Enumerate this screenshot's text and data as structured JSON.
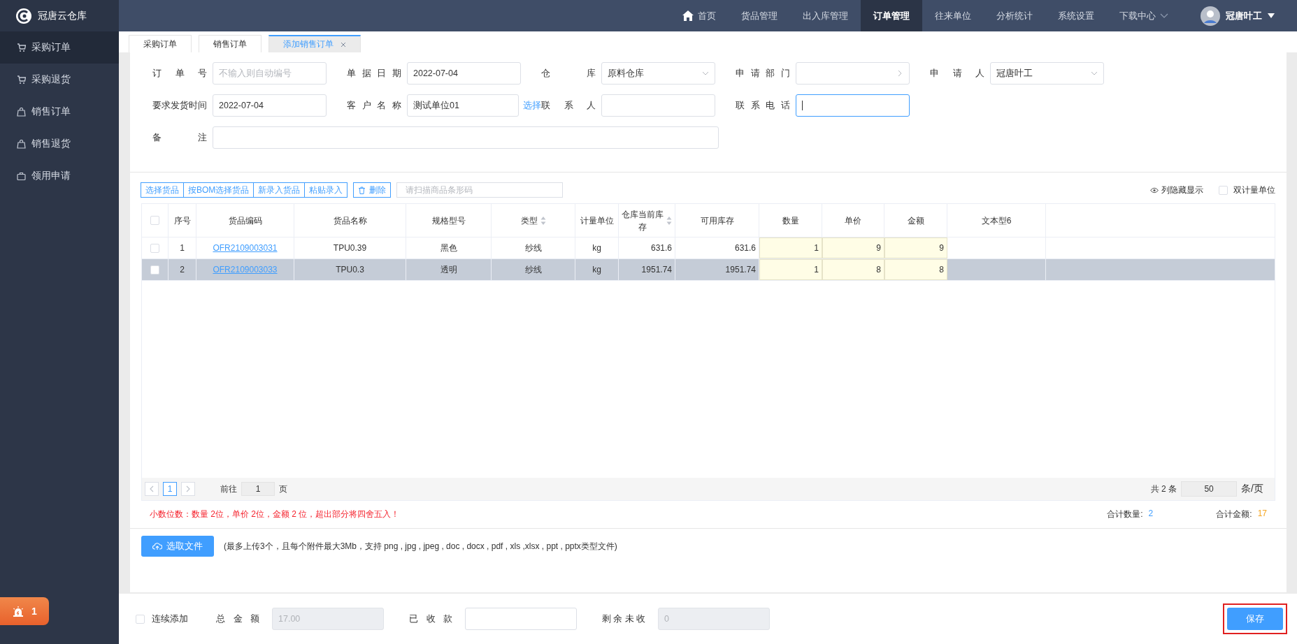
{
  "app": {
    "logo_text": "冠唐云仓库"
  },
  "nav": [
    {
      "label": "首页",
      "selected": false,
      "kind": "home"
    },
    {
      "label": "货品管理",
      "selected": false,
      "kind": "plain"
    },
    {
      "label": "出入库管理",
      "selected": false,
      "kind": "plain"
    },
    {
      "label": "订单管理",
      "selected": true,
      "kind": "plain"
    },
    {
      "label": "往来单位",
      "selected": false,
      "kind": "plain"
    },
    {
      "label": "分析统计",
      "selected": false,
      "kind": "plain"
    },
    {
      "label": "系统设置",
      "selected": false,
      "kind": "plain"
    },
    {
      "label": "下载中心",
      "selected": false,
      "kind": "dropdown"
    }
  ],
  "user": {
    "name": "冠唐叶工"
  },
  "sidebar": {
    "items": [
      {
        "label": "采购订单",
        "selected": true,
        "kind": "cart"
      },
      {
        "label": "采购退货",
        "selected": false,
        "kind": "cart"
      },
      {
        "label": "销售订单",
        "selected": false,
        "kind": "bag"
      },
      {
        "label": "销售退货",
        "selected": false,
        "kind": "bag"
      },
      {
        "label": "领用申请",
        "selected": false,
        "kind": "case"
      }
    ]
  },
  "alert_badge": {
    "count": "1"
  },
  "tabs": [
    {
      "label": "采购订单",
      "selected": false,
      "closable": false
    },
    {
      "label": "销售订单",
      "selected": false,
      "closable": false
    },
    {
      "label": "添加销售订单",
      "selected": true,
      "closable": true
    }
  ],
  "form": {
    "rows": [
      [
        {
          "label": "订单号",
          "kind": "text",
          "placeholder": "不输入则自动编号",
          "focused": false
        },
        {
          "label": "单据日期",
          "kind": "text",
          "value": "2022-07-04",
          "focused": false
        },
        {
          "label": "仓库",
          "kind": "select",
          "value": "原料仓库",
          "focused": false
        },
        {
          "label": "申请部门",
          "kind": "picker",
          "focused": false
        },
        {
          "label": "申请人",
          "kind": "select",
          "value": "冠唐叶工",
          "focused": false
        }
      ],
      [
        {
          "label": "要求发货时间",
          "kind": "text",
          "value": "2022-07-04",
          "focused": false
        },
        {
          "label": "客户名称",
          "kind": "text",
          "value": "测试单位01",
          "action": "选择",
          "focused": false
        },
        {
          "label": "联系人",
          "kind": "text",
          "focused": false
        },
        {
          "label": "联系电话",
          "kind": "text",
          "focused": true
        }
      ],
      [
        {
          "label": "备注",
          "kind": "wide",
          "focused": false
        }
      ]
    ]
  },
  "toolbar": {
    "buttons": [
      "选择货品",
      "按BOM选择货品",
      "新录入货品",
      "粘贴录入"
    ],
    "delete_button": "删除",
    "barcode_placeholder": "请扫描商品条形码",
    "column_toggle": "列隐藏显示",
    "dual_unit": {
      "label": "双计量单位",
      "checked": false
    }
  },
  "table": {
    "header_checked": false,
    "columns": [
      {
        "label": "序号",
        "sortable": false,
        "kind": "plain"
      },
      {
        "label": "货品编码",
        "sortable": false,
        "kind": "link"
      },
      {
        "label": "货品名称",
        "sortable": false,
        "kind": "plain"
      },
      {
        "label": "规格型号",
        "sortable": false,
        "kind": "plain"
      },
      {
        "label": "类型",
        "sortable": true,
        "kind": "plain"
      },
      {
        "label": "计量单位",
        "sortable": false,
        "kind": "plain"
      },
      {
        "label": "仓库当前库存",
        "sortable": true,
        "kind": "number"
      },
      {
        "label": "可用库存",
        "sortable": false,
        "kind": "number"
      },
      {
        "label": "数量",
        "sortable": false,
        "kind": "editable"
      },
      {
        "label": "单价",
        "sortable": false,
        "kind": "editable"
      },
      {
        "label": "金额",
        "sortable": false,
        "kind": "editable"
      },
      {
        "label": "文本型6",
        "sortable": false,
        "kind": "plain"
      }
    ],
    "rows": [
      {
        "selected": false,
        "checked": false,
        "cells": [
          "1",
          "OFR2109003031",
          "TPU0.39",
          "黑色",
          "纱线",
          "kg",
          "631.6",
          "631.6",
          "1",
          "9",
          "9",
          ""
        ]
      },
      {
        "selected": true,
        "checked": false,
        "cells": [
          "2",
          "OFR2109003033",
          "TPU0.3",
          "透明",
          "纱线",
          "kg",
          "1951.74",
          "1951.74",
          "1",
          "8",
          "8",
          ""
        ]
      }
    ]
  },
  "pagination": {
    "current": "1",
    "goto_label": "前往",
    "goto_value": "1",
    "goto_suffix": "页",
    "total": "共 2 条",
    "page_size": "50",
    "page_size_suffix": "条/页"
  },
  "note": "小数位数：数量 2位，单价 2位，金额 2 位，超出部分将四舍五入！",
  "totals": [
    {
      "label": "合计数量:",
      "value": "2",
      "color": "#409eff"
    },
    {
      "label": "合计金额:",
      "value": "17",
      "color": "#f5a623"
    }
  ],
  "upload": {
    "button": "选取文件",
    "hint": "(最多上传3个，且每个附件最大3Mb，支持 png , jpg , jpeg , doc , docx , pdf , xls ,xlsx , ppt , pptx类型文件)"
  },
  "footer": {
    "continuous": {
      "label": "连续添加",
      "checked": false
    },
    "fields": [
      {
        "label": "总金额",
        "value": "17.00",
        "disabled": true
      },
      {
        "label": "已收款",
        "disabled": false
      },
      {
        "label": "剩余未收",
        "value": "0",
        "disabled": true
      }
    ],
    "save": {
      "label": "保存",
      "highlighted": true
    }
  }
}
